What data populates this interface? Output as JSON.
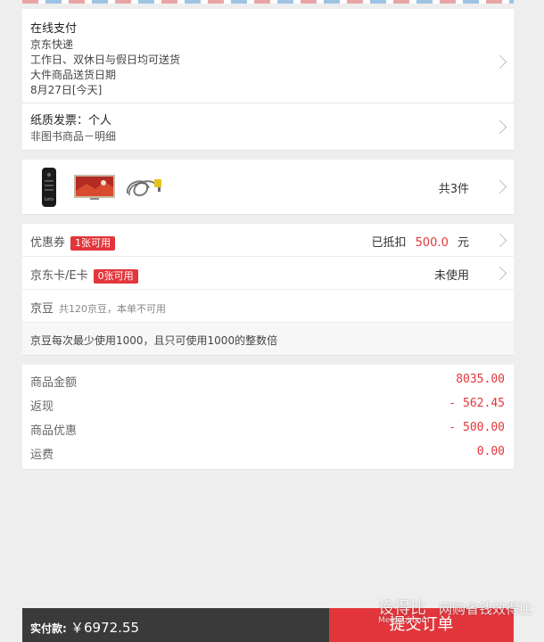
{
  "delivery": {
    "payment": "在线支付",
    "carrier": "京东快递",
    "schedule": "工作日、双休日与假日均可送货",
    "large_item": "大件商品送货日期",
    "date": "8月27日[今天]"
  },
  "invoice": {
    "title": "纸质发票：个人",
    "detail": "非图书商品－明细"
  },
  "products": {
    "count_label": "共3件",
    "items": [
      {
        "icon": "remote-control-icon"
      },
      {
        "icon": "tv-screen-icon"
      },
      {
        "icon": "cable-icon"
      }
    ]
  },
  "coupon": {
    "label": "优惠券",
    "badge": "1张可用",
    "deducted_prefix": "已抵扣",
    "deducted_amount": "500.0",
    "unit": "元"
  },
  "jdcard": {
    "label": "京东卡/E卡",
    "badge": "0张可用",
    "status": "未使用"
  },
  "beans": {
    "label": "京豆",
    "sub": "共120京豆，本单不可用",
    "note": "京豆每次最少使用1000，且只可使用1000的整数倍"
  },
  "summary": [
    {
      "label": "商品金额",
      "value": "8035.00"
    },
    {
      "label": "返现",
      "value": "- 562.45"
    },
    {
      "label": "商品优惠",
      "value": "- 500.00"
    },
    {
      "label": "运费",
      "value": "0.00"
    }
  ],
  "footer": {
    "pay_label": "实付款:",
    "pay_amount": "￥6972.55",
    "submit": "提交订单"
  },
  "watermark": {
    "brand": "设得比",
    "domain": "Meidebi.com",
    "slogan": "网购省钱效得比"
  },
  "colors": {
    "accent": "#e2363c",
    "footer_dark": "#3a3a3a",
    "background": "#eeeeee"
  }
}
